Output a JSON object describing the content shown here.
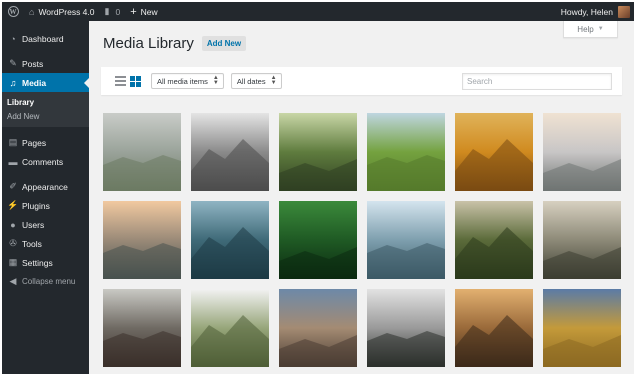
{
  "adminbar": {
    "site_name": "WordPress 4.0",
    "comments_count": "0",
    "new_label": "New",
    "greeting": "Howdy, Helen"
  },
  "sidebar": {
    "items": [
      {
        "label": "Dashboard",
        "icon": "dashboard-icon"
      },
      {
        "label": "Posts",
        "icon": "pushpin-icon"
      },
      {
        "label": "Media",
        "icon": "media-icon",
        "active": true
      },
      {
        "label": "Pages",
        "icon": "page-icon"
      },
      {
        "label": "Comments",
        "icon": "comment-icon"
      },
      {
        "label": "Appearance",
        "icon": "paintbrush-icon"
      },
      {
        "label": "Plugins",
        "icon": "plugin-icon"
      },
      {
        "label": "Users",
        "icon": "user-icon"
      },
      {
        "label": "Tools",
        "icon": "wrench-icon"
      },
      {
        "label": "Settings",
        "icon": "settings-icon"
      }
    ],
    "media_submenu": [
      "Library",
      "Add New"
    ],
    "collapse_label": "Collapse menu"
  },
  "main": {
    "help_label": "Help",
    "page_title": "Media Library",
    "add_new_label": "Add New",
    "filter_type": "All media items",
    "filter_date": "All dates",
    "search_placeholder": "Search",
    "view_modes": [
      "list-view-icon",
      "grid-view-icon"
    ],
    "selected_view": "grid"
  },
  "colors": {
    "adminbar_bg": "#23282d",
    "sidebar_bg": "#23282d",
    "active_menu": "#0073aa",
    "page_bg": "#f1f1f1",
    "link_blue": "#0073aa"
  },
  "media_items": [
    {
      "name": "misty-valley-photo",
      "colors": [
        "#c9ccc8",
        "#9aa39a",
        "#6c7a62"
      ]
    },
    {
      "name": "mountain-glacier-photo",
      "colors": [
        "#e4e4e4",
        "#8a8a8a",
        "#4c4c4c"
      ]
    },
    {
      "name": "forest-sunlight-photo",
      "colors": [
        "#c8d6a6",
        "#5f7c3e",
        "#2f3f22"
      ]
    },
    {
      "name": "green-hills-photo",
      "colors": [
        "#bfd6e0",
        "#74a23f",
        "#557a2b"
      ]
    },
    {
      "name": "spiky-flower-photo",
      "colors": [
        "#e0b35a",
        "#d08a1f",
        "#7a4a12"
      ]
    },
    {
      "name": "snowy-trees-photo",
      "colors": [
        "#f0e2d2",
        "#c8c6c6",
        "#6f7472"
      ]
    },
    {
      "name": "cliff-sunset-photo",
      "colors": [
        "#f1c9a0",
        "#9a8a78",
        "#48524f"
      ]
    },
    {
      "name": "lake-islands-photo",
      "colors": [
        "#8fb4c3",
        "#3f6a78",
        "#1d3b45"
      ]
    },
    {
      "name": "green-leaves-photo",
      "colors": [
        "#3b8a3b",
        "#1f5a24",
        "#0b2a10"
      ]
    },
    {
      "name": "lake-sky-photo",
      "colors": [
        "#d4e4ee",
        "#7e9fae",
        "#3c5a66"
      ]
    },
    {
      "name": "forest-cabin-photo",
      "colors": [
        "#c9c2a8",
        "#5b6b3a",
        "#2b3a1c"
      ]
    },
    {
      "name": "mountain-lake-dusk-photo",
      "colors": [
        "#d7d0c0",
        "#8d8a78",
        "#3d3e32"
      ]
    },
    {
      "name": "waterfall-rocks-photo",
      "colors": [
        "#c9c9c4",
        "#6f6a63",
        "#3a2f2a"
      ]
    },
    {
      "name": "snow-ridge-photo",
      "colors": [
        "#f2f2f2",
        "#97a67a",
        "#4f5e36"
      ]
    },
    {
      "name": "desert-road-photo",
      "colors": [
        "#6d89a8",
        "#a48b73",
        "#4b3d33"
      ]
    },
    {
      "name": "pine-forest-fog-photo",
      "colors": [
        "#e2e2e2",
        "#9a9a9a",
        "#2b2f2b"
      ]
    },
    {
      "name": "coastal-cliffs-photo",
      "colors": [
        "#e2b070",
        "#9a6a3a",
        "#3d2a1a"
      ]
    },
    {
      "name": "golden-hills-photo",
      "colors": [
        "#5b7ba6",
        "#c49a3a",
        "#8d6a22"
      ]
    }
  ]
}
